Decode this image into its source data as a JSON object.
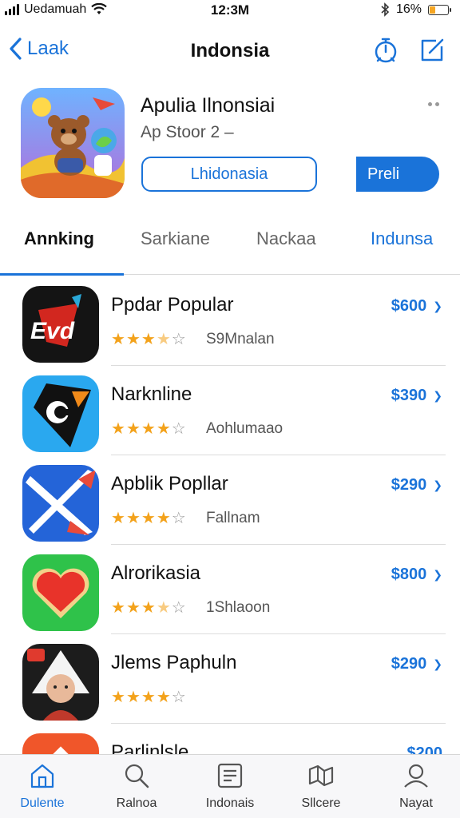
{
  "status_bar": {
    "carrier": "Uedamuah",
    "time": "12:3M",
    "battery_percent": "16%",
    "battery_level": 0.3
  },
  "nav": {
    "back_label": "Laak",
    "title": "Indonsia",
    "icons": [
      "back-chevron-icon",
      "timer-icon",
      "compose-icon"
    ]
  },
  "app": {
    "title": "Apulia Ilnonsiai",
    "subtitle": "Ap Stoor 2 –",
    "outline_button": "Lhidonasia",
    "get_button": "Preli"
  },
  "tabs": [
    {
      "label": "Annking",
      "state": "active"
    },
    {
      "label": "Sarkiane",
      "state": "inactive"
    },
    {
      "label": "Nackaa",
      "state": "inactive"
    },
    {
      "label": "Indunsa",
      "state": "blue"
    }
  ],
  "apps": [
    {
      "name": "Ppdar Popular",
      "rating": 3.5,
      "sub": "S9Mnalan",
      "price": "$600",
      "icon": "evd-red-icon"
    },
    {
      "name": "Narknline",
      "rating": 4,
      "sub": "Aohlumaao",
      "price": "$390",
      "icon": "blue-kite-icon"
    },
    {
      "name": "Apblik Popllar",
      "rating": 4,
      "sub": "Fallnam",
      "price": "$290",
      "icon": "cross-arrow-icon"
    },
    {
      "name": "Alrorikasia",
      "rating": 3.5,
      "sub": "1Shlaoon",
      "price": "$800",
      "icon": "heart-icon"
    },
    {
      "name": "Jlems Paphuln",
      "rating": 4,
      "sub": "",
      "price": "$290",
      "icon": "portrait-icon"
    },
    {
      "name": "Parlinlsle",
      "rating": 0,
      "sub": "",
      "price": "$200",
      "icon": "orange-app-icon"
    }
  ],
  "tab_bar": [
    {
      "label": "Dulente",
      "icon": "home-icon",
      "active": true
    },
    {
      "label": "Ralnoa",
      "icon": "search-icon",
      "active": false
    },
    {
      "label": "Indonais",
      "icon": "list-icon",
      "active": false
    },
    {
      "label": "Sllcere",
      "icon": "map-icon",
      "active": false
    },
    {
      "label": "Nayat",
      "icon": "profile-icon",
      "active": false
    }
  ],
  "colors": {
    "accent": "#1a73d9",
    "star": "#f3a21b",
    "battery": "#f6a623"
  }
}
